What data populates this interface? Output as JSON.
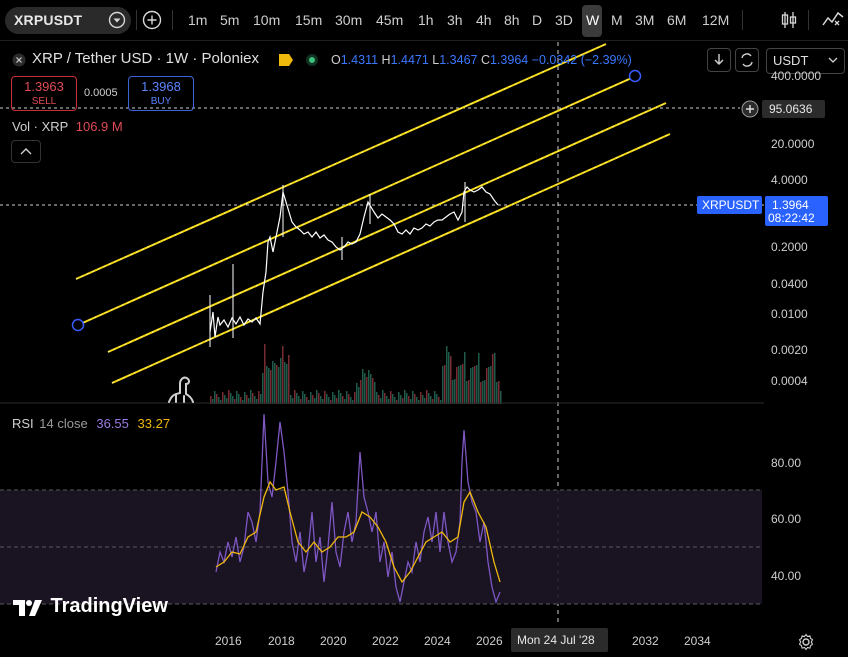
{
  "toolbar": {
    "symbol": "XRPUSDT",
    "timeframes": [
      "1m",
      "5m",
      "10m",
      "15m",
      "30m",
      "45m",
      "1h",
      "3h",
      "4h",
      "8h",
      "D",
      "3D",
      "W",
      "M",
      "3M",
      "6M",
      "12M"
    ],
    "active_timeframe": "W"
  },
  "legend": {
    "title": "XRP / Tether USD · 1W · Poloniex",
    "open_label": "O",
    "open": "1.4311",
    "high_label": "H",
    "high": "1.4471",
    "low_label": "L",
    "low": "1.3467",
    "close_label": "C",
    "close": "1.3964",
    "change": "−0.0342 (−2.39%)",
    "sell_price": "1.3963",
    "sell_label": "SELL",
    "buy_price": "1.3968",
    "buy_label": "BUY",
    "spread": "0.0005",
    "vol_label": "Vol · XRP",
    "vol_value": "106.9 M",
    "rsi_label": "RSI",
    "rsi_params": "14 close",
    "rsi_value": "36.55",
    "rsi_ma_value": "33.27"
  },
  "price_axis": {
    "currency": "USDT",
    "ticks": [
      "400.0000",
      "20.0000",
      "4.0000",
      "0.2000",
      "0.0400",
      "0.0100",
      "0.0020",
      "0.0004"
    ],
    "crosshair_price": "95.0636",
    "last_symbol": "XRPUSDT",
    "last_price": "1.3964",
    "countdown": "08:22:42"
  },
  "rsi_axis": {
    "ticks": [
      "80.00",
      "60.00",
      "40.00"
    ]
  },
  "time_axis": {
    "ticks": [
      "2016",
      "2018",
      "2020",
      "2022",
      "2024",
      "2026",
      "2032",
      "2034"
    ],
    "crosshair_date": "Mon 24 Jul '28"
  },
  "branding": {
    "logo_text": "TradingView"
  },
  "colors": {
    "accent_blue": "#3a78ff",
    "channel_yellow": "#f5d90a",
    "sell_red": "#c5303a",
    "rsi_purple": "#7e57c2",
    "rsi_ma_yellow": "#f0b90b"
  }
}
